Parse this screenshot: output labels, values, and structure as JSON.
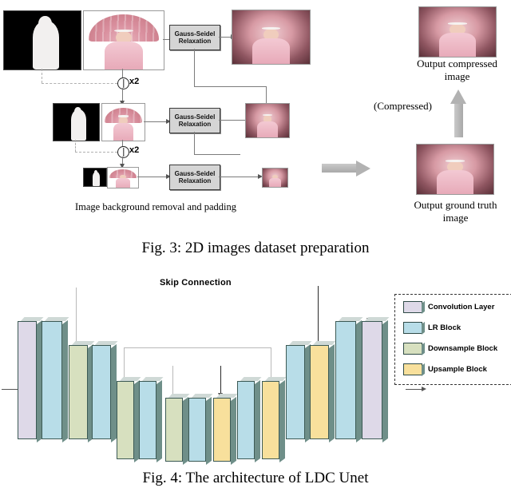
{
  "page": {
    "figures": [
      {
        "id": "fig3",
        "caption": "Fig. 3: 2D images dataset preparation",
        "sublabel": "Image background removal and padding",
        "process_boxes": [
          {
            "line1": "Gauss-Seidel",
            "line2": "Relaxation"
          },
          {
            "line1": "Gauss-Seidel",
            "line2": "Relaxation"
          },
          {
            "line1": "Gauss-Seidel",
            "line2": "Relaxation"
          }
        ],
        "scale_markers": [
          {
            "label": "x2"
          },
          {
            "label": "x2"
          }
        ],
        "right_labels": {
          "compressed_output": "Output compressed image",
          "compressed_output_line1": "Output compressed",
          "compressed_output_line2": "image",
          "compressed_arrow": "(Compressed)",
          "ground_truth": "Output ground truth image",
          "ground_truth_line1": "Output ground truth",
          "ground_truth_line2": "image"
        }
      },
      {
        "id": "fig4",
        "caption": "Fig. 4: The architecture of LDC Unet",
        "skip_label": "Skip Connection",
        "legend": [
          {
            "label": "Convolution Layer",
            "color": "#ded9e8"
          },
          {
            "label": "LR Block",
            "color": "#b8dde8"
          },
          {
            "label": "Downsample Block",
            "color": "#d7e0bf"
          },
          {
            "label": "Upsample Block",
            "color": "#f8e09c"
          }
        ],
        "blocks": [
          {
            "type": "Convolution Layer",
            "color": "#ded9e8"
          },
          {
            "type": "LR Block",
            "color": "#b8dde8"
          },
          {
            "type": "Downsample Block",
            "color": "#d7e0bf"
          },
          {
            "type": "LR Block",
            "color": "#b8dde8"
          },
          {
            "type": "Downsample Block",
            "color": "#d7e0bf"
          },
          {
            "type": "LR Block",
            "color": "#b8dde8"
          },
          {
            "type": "Downsample Block",
            "color": "#d7e0bf"
          },
          {
            "type": "LR Block",
            "color": "#b8dde8"
          },
          {
            "type": "Upsample Block",
            "color": "#f8e09c"
          },
          {
            "type": "LR Block",
            "color": "#b8dde8"
          },
          {
            "type": "Upsample Block",
            "color": "#f8e09c"
          },
          {
            "type": "LR Block",
            "color": "#b8dde8"
          },
          {
            "type": "Upsample Block",
            "color": "#f8e09c"
          },
          {
            "type": "LR Block",
            "color": "#b8dde8"
          },
          {
            "type": "Convolution Layer",
            "color": "#ded9e8"
          }
        ]
      }
    ]
  }
}
